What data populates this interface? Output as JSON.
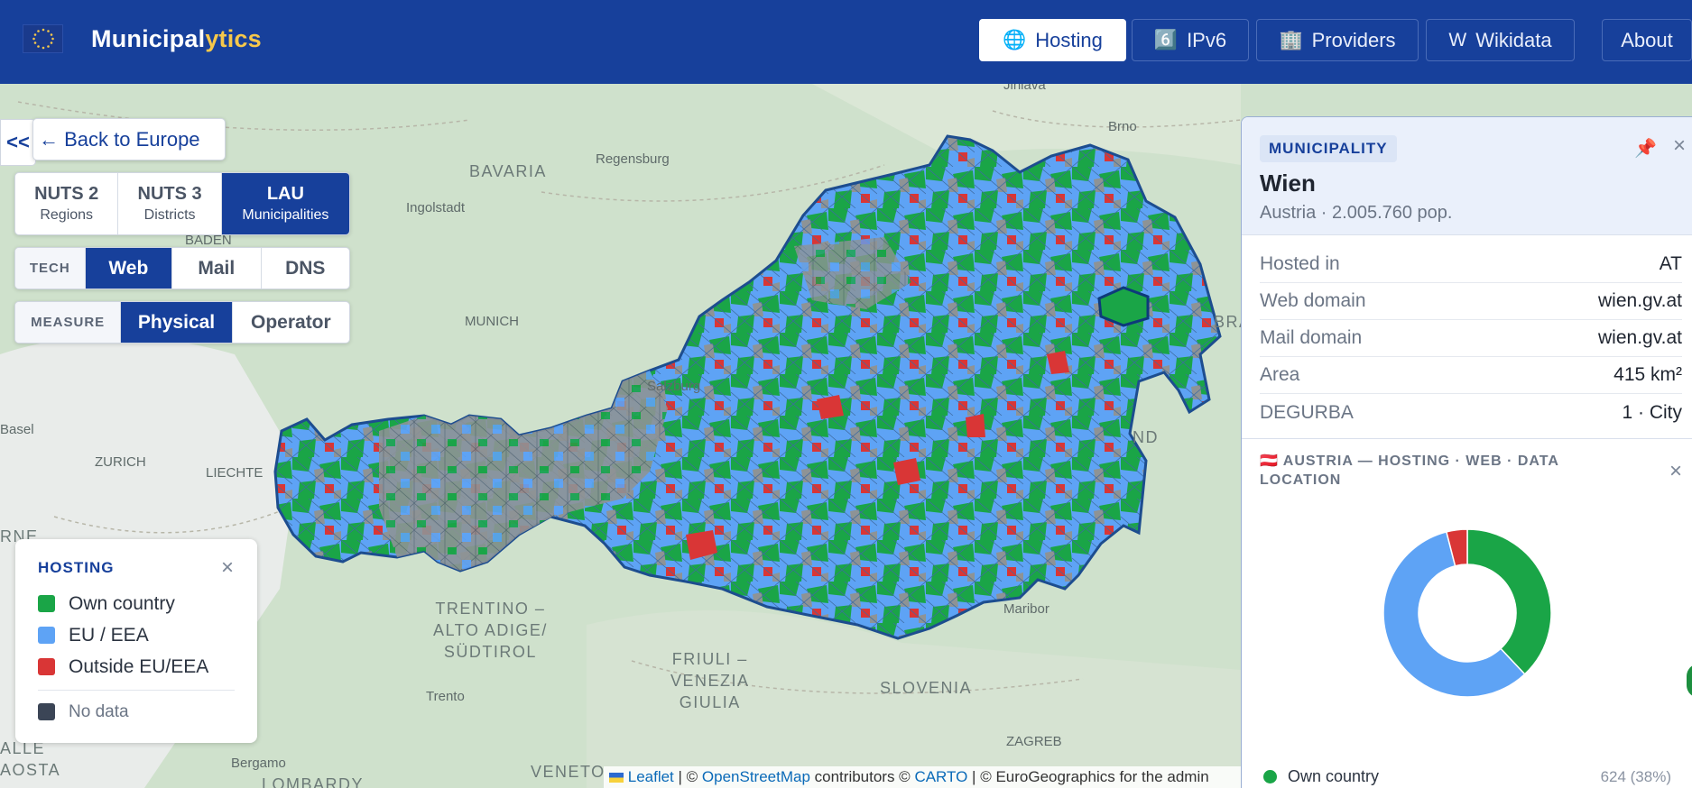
{
  "header": {
    "brand_main": "Municipal",
    "brand_accent": "ytics",
    "nav": [
      {
        "icon": "🌐",
        "label": "Hosting",
        "active": true
      },
      {
        "icon": "6️⃣",
        "label": "IPv6",
        "active": false
      },
      {
        "icon": "🏢",
        "label": "Providers",
        "active": false
      },
      {
        "icon": "W",
        "label": "Wikidata",
        "active": false
      },
      {
        "icon": "",
        "label": "About",
        "active": false
      }
    ]
  },
  "controls": {
    "collapse_label": "<<",
    "back_label": "← Back to Europe",
    "levels": [
      {
        "label": "NUTS 2",
        "sub": "Regions"
      },
      {
        "label": "NUTS 3",
        "sub": "Districts"
      },
      {
        "label": "LAU",
        "sub": "Municipalities"
      }
    ],
    "tech_tag": "TECH",
    "tech": [
      "Web",
      "Mail",
      "DNS"
    ],
    "measure_tag": "MEASURE",
    "measure": [
      "Physical",
      "Operator"
    ]
  },
  "legend": {
    "title": "HOSTING",
    "close": "×",
    "items": [
      {
        "label": "Own country",
        "color": "#1aa547"
      },
      {
        "label": "EU / EEA",
        "color": "#5ea3f5"
      },
      {
        "label": "Outside EU/EEA",
        "color": "#d93636"
      }
    ],
    "nodata": {
      "label": "No data",
      "color": "#3b4556"
    }
  },
  "map_labels": {
    "bavaria": "BAVARIA",
    "regensburg": "Regensburg",
    "ingolstadt": "Ingolstadt",
    "munich": "MUNICH",
    "salzburg": "Salzburg",
    "zurich": "ZURICH",
    "liechte": "LIECHTE",
    "basel": "Basel",
    "trentino": "TRENTINO –\nALTO ADIGE/\nSÜDTIROL",
    "trento": "Trento",
    "friuli": "FRIULI –\nVENEZIA\nGIULIA",
    "slovenia": "SLOVENIA",
    "maribor": "Maribor",
    "zagreb": "ZAGREB",
    "brno": "Brno",
    "jihlava": "Jihlava",
    "bergamo": "Bergamo",
    "lombardy": "LOMBARDY",
    "veneto": "VENETO",
    "aosta": "ALLE\nAOSTA",
    "rne": "RNE",
    "nd": "ND",
    "bra": "BRA",
    "baden": "BADEN"
  },
  "attribution": {
    "leaflet": "Leaflet",
    "sep1": " | © ",
    "osm": "OpenStreetMap",
    "mid": " contributors © ",
    "carto": "CARTO",
    "tail": " | © EuroGeographics for the admin"
  },
  "municipality": {
    "chip": "MUNICIPALITY",
    "name": "Wien",
    "meta": "Austria · 2.005.760 pop.",
    "pin": "📌",
    "close": "×",
    "props": [
      {
        "key": "Hosted in",
        "value": "AT"
      },
      {
        "key": "Web domain",
        "value": "wien.gv.at"
      },
      {
        "key": "Mail domain",
        "value": "wien.gv.at"
      },
      {
        "key": "Area",
        "value": "415 km²"
      },
      {
        "key": "DEGURBA",
        "value": "1 · City"
      }
    ]
  },
  "country_stats": {
    "title": "🇦🇹 AUSTRIA — HOSTING · WEB · DATA LOCATION",
    "close": "×",
    "chart_data": {
      "type": "pie",
      "categories": [
        "Own country",
        "EU / EEA",
        "Outside EU/EEA"
      ],
      "values": [
        38,
        58,
        4
      ],
      "colors": [
        "#1aa547",
        "#5ea3f5",
        "#d93636"
      ]
    },
    "first_row": {
      "label": "Own country",
      "count": "624 (38%)"
    }
  }
}
